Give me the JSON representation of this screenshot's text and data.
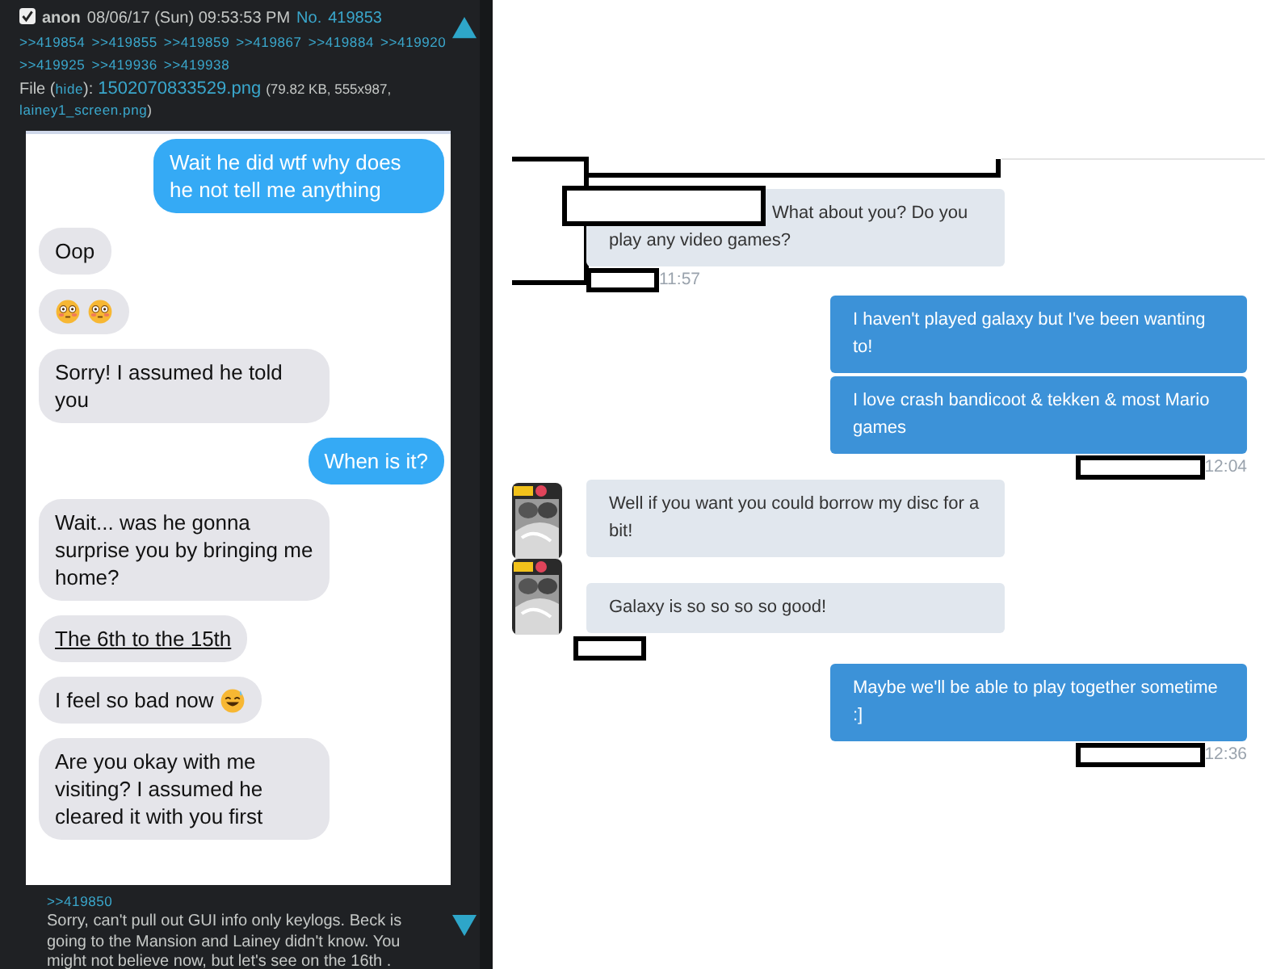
{
  "post": {
    "checked": true,
    "name": "anon",
    "date": "08/06/17 (Sun) 09:53:53 PM",
    "number_label": "No.",
    "number": "419853",
    "backlinks": [
      ">>419854",
      ">>419855",
      ">>419859",
      ">>419867",
      ">>419884",
      ">>419920",
      ">>419925",
      ">>419936",
      ">>419938"
    ],
    "file": {
      "label": "File (",
      "hide": "hide",
      "after_hide": "):",
      "filename": "1502070833529.png",
      "meta": "(79.82 KB, 555x987,",
      "original_name": "lainey1_screen.png",
      "close": ")"
    },
    "quote": ">>419850",
    "comment": "Sorry, can't pull out GUI info only keylogs. Beck is going to the Mansion and Lainey didn't know. You might not believe now, but let's see on the 16th ."
  },
  "phone_chat": [
    {
      "kind": "sent",
      "text": "Wait he did wtf why does he not tell me anything"
    },
    {
      "kind": "received",
      "text": "Oop"
    },
    {
      "kind": "received",
      "emoji": [
        {
          "kind": "flushed"
        },
        {
          "kind": "flushed"
        }
      ]
    },
    {
      "kind": "received",
      "text": "Sorry! I assumed he told you"
    },
    {
      "kind": "sent",
      "text": "When is it?"
    },
    {
      "kind": "received",
      "text": "Wait... was he gonna surprise you by bringing me home?"
    },
    {
      "kind": "date_link",
      "text": "The 6th to the 15th"
    },
    {
      "kind": "received",
      "text": "I feel so bad now",
      "emoji": [
        {
          "kind": "sweat_smile"
        }
      ]
    },
    {
      "kind": "received",
      "text": "Are you okay with me visiting? I assumed he cleared it with you first"
    }
  ],
  "web_chat": [
    {
      "kind": "received",
      "avatar": false,
      "redacted": true,
      "text": "What about you? Do you play any video games?",
      "footer": {
        "redacted": true,
        "time": "11:57"
      }
    },
    {
      "kind": "sent",
      "avatar": false,
      "redacted": false,
      "text": "I haven't played galaxy but I've been wanting to!"
    },
    {
      "kind": "sent",
      "avatar": false,
      "redacted": false,
      "text": "I love crash bandicoot & tekken & most Mario games",
      "footer": {
        "redacted": true,
        "time": "12:04"
      }
    },
    {
      "kind": "received",
      "avatar": true,
      "redacted": false,
      "text": "Well if you want you could borrow my disc for a bit!"
    },
    {
      "kind": "received",
      "avatar": true,
      "redacted": false,
      "text": "Galaxy is so so so so good!",
      "footer": {
        "redacted": true
      }
    },
    {
      "kind": "sent",
      "avatar": false,
      "redacted": false,
      "text": "Maybe we'll be able to play together sometime :]",
      "footer": {
        "redacted": true,
        "time": "12:36"
      }
    }
  ]
}
